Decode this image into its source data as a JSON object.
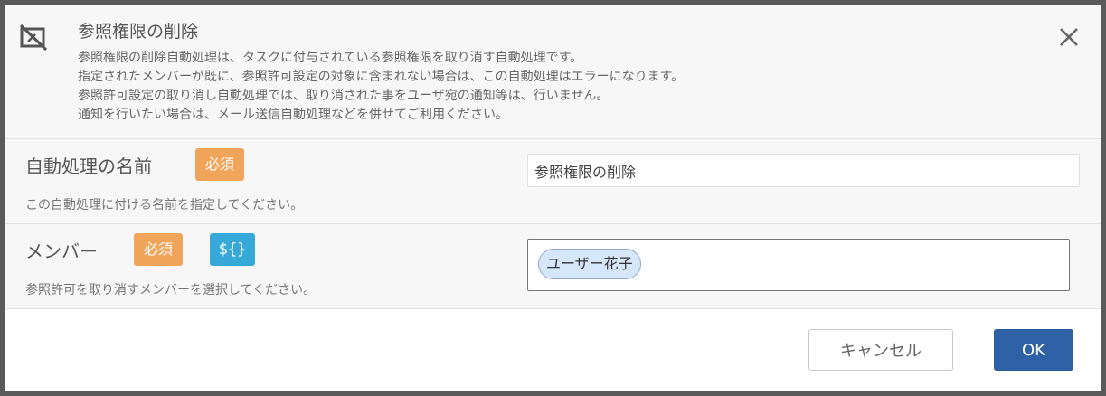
{
  "dialog": {
    "title": "参照権限の削除",
    "icon": "no-view-permission-icon",
    "description": [
      "参照権限の削除自動処理は、タスクに付与されている参照権限を取り消す自動処理です。",
      "指定されたメンバーが既に、参照許可設定の対象に含まれない場合は、この自動処理はエラーになります。",
      "参照許可設定の取り消し自動処理では、取り消された事をユーザ宛の通知等は、行いません。",
      "通知を行いたい場合は、メール送信自動処理などを併せてご利用ください。"
    ],
    "close_icon": "close-icon"
  },
  "fields": {
    "name": {
      "label": "自動処理の名前",
      "required_badge": "必須",
      "hint": "この自動処理に付ける名前を指定してください。",
      "value": "参照権限の削除"
    },
    "member": {
      "label": "メンバー",
      "required_badge": "必須",
      "variable_badge": "${}",
      "hint": "参照許可を取り消すメンバーを選択してください。",
      "selected": [
        "ユーザー花子"
      ]
    }
  },
  "footer": {
    "cancel_label": "キャンセル",
    "ok_label": "OK"
  },
  "colors": {
    "required": "#f0a55a",
    "variable": "#37a9d8",
    "primary": "#2f61a6",
    "chip": "#d6e6fb"
  }
}
